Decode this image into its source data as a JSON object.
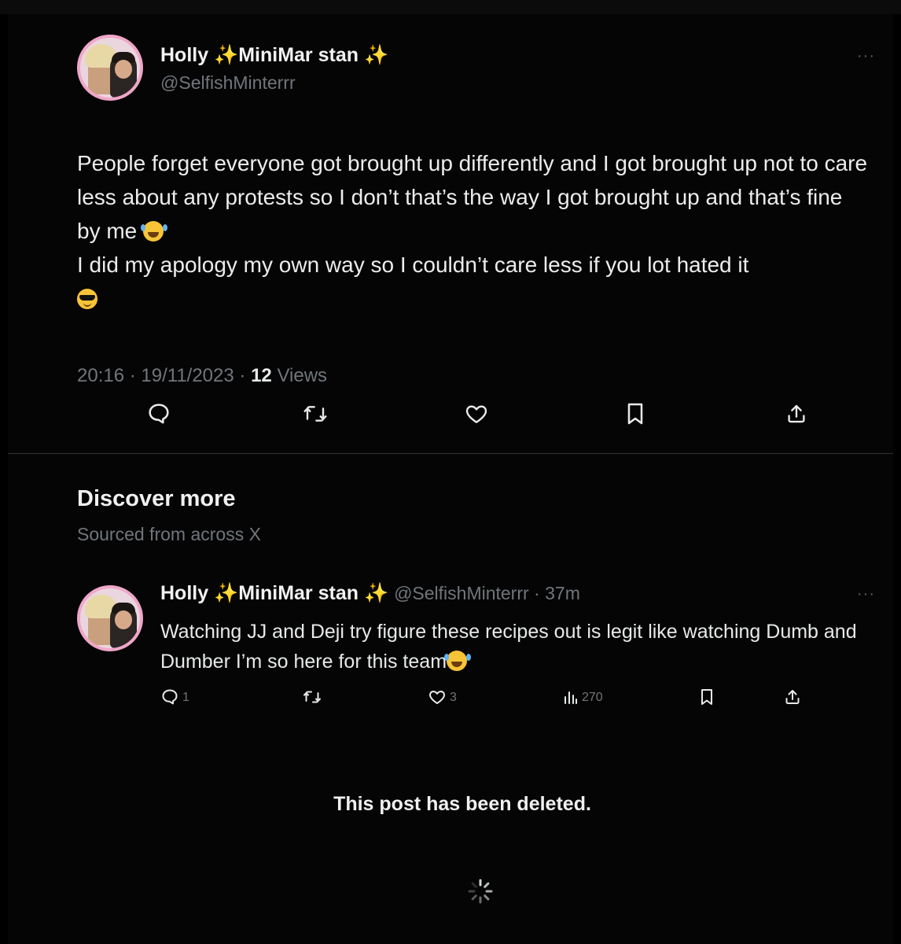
{
  "main_post": {
    "display_name": "Holly",
    "name_suffix": "MiniMar stan",
    "sparkle": "✨",
    "handle": "@SelfishMinterrr",
    "more": "···",
    "text_line1": "People forget everyone got brought up differently and I got brought up not to care less about any protests so I don’t that’s the way I got brought up and that’s fine by me",
    "text_line2": "I did my apology my own way so I couldn’t care less if you lot hated it",
    "emoji1": "face-with-tears-of-joy",
    "emoji2": "smiling-face-with-sunglasses",
    "time": "20:16",
    "date": "19/11/2023",
    "separator": " · ",
    "views_count": "12",
    "views_label": "Views",
    "actions": [
      "reply-icon",
      "repost-icon",
      "like-icon",
      "bookmark-icon",
      "share-icon"
    ]
  },
  "discover": {
    "title": "Discover more",
    "subtitle": "Sourced from across X"
  },
  "suggested_post": {
    "display_name": "Holly",
    "name_suffix": "MiniMar stan",
    "sparkle": "✨",
    "handle": "@SelfishMinterrr",
    "separator": " · ",
    "time_ago": "37m",
    "more": "···",
    "text": "Watching JJ and Deji try figure these recipes out is legit like watching Dumb and Dumber I’m so here for this team",
    "emoji": "loudly-crying-face",
    "reply_count": "1",
    "like_count": "3",
    "views_count": "270"
  },
  "deleted_notice": "This post has been deleted.",
  "colors": {
    "background": "#000000",
    "text_primary": "#e7e9ea",
    "text_secondary": "#71767b",
    "avatar_ring": "#f0a6c9",
    "sparkle": "#f3c646"
  }
}
